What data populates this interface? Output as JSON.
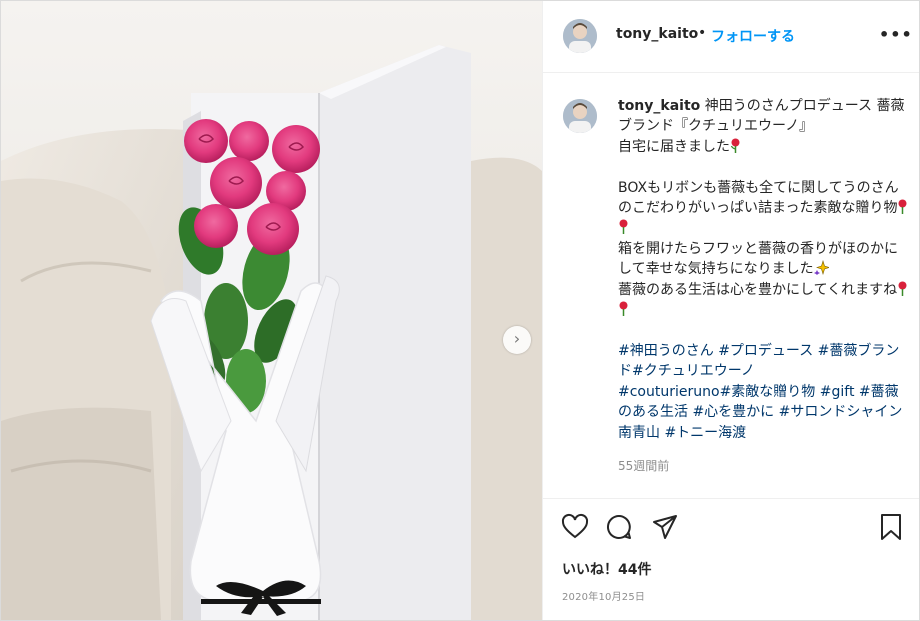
{
  "post": {
    "username": "tony_kaito",
    "separator": "•",
    "follow_label": "フォローする",
    "more_icon": "more-options-icon",
    "caption": {
      "user": "tony_kaito",
      "line1": " 神田うのさんプロデュース 薔薇ブランド『クチュリエウーノ』",
      "line2": "自宅に届きました",
      "line3": "BOXもリボンも薔薇も全てに関してうのさんのこだわりがいっぱい詰まった素敵な贈り物",
      "line4": "箱を開けたらフワッと薔薇の香りがほのかにして幸せな気持ちになりました",
      "line5": "薔薇のある生活は心を豊かにしてくれますね",
      "hashtags": [
        "#神田うのさん",
        "#プロデュース",
        "#薔薇ブランド",
        "#クチュリエウーノ",
        "#couturieruno",
        "#素敵な贈り物",
        "#gift",
        "#薔薇のある生活",
        "#心を豊かに",
        "#サロンドシャイン南青山",
        "#トニー海渡"
      ]
    },
    "time_ago": "55週間前",
    "likes": "いいね！44件",
    "date": "2020年10月25日",
    "icons": {
      "like": "heart-icon",
      "comment": "comment-icon",
      "share": "share-icon",
      "save": "bookmark-icon",
      "next": "chevron-right-icon"
    },
    "colors": {
      "follow": "#0095f6",
      "hashtag": "#00376b",
      "muted": "#8e8e8e",
      "text": "#262626"
    }
  }
}
